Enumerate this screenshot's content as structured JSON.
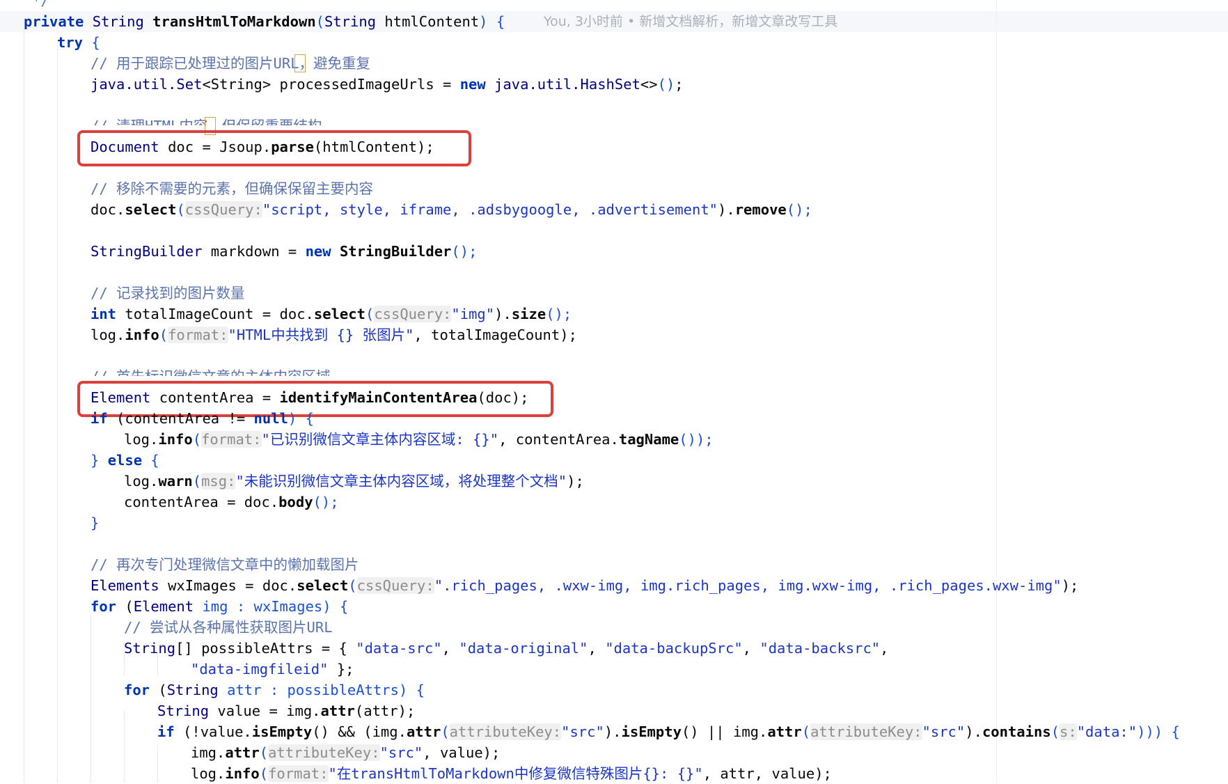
{
  "colors": {
    "keyword": "#0033b3",
    "comment": "#5b74ad",
    "string": "#1b35c9",
    "parameter_hint": "#8c8c8c",
    "highlight_box": "#d9413c",
    "background": "#ffffff"
  },
  "code": {
    "l0": {
      "comment": "*/"
    },
    "l1": {
      "kw_private": "private",
      "type": "String",
      "method": "transHtmlToMarkdown",
      "open": "(",
      "ptype": "String",
      "param": "htmlContent",
      "close": ") {",
      "blame": "You, 3小时前 • 新增文档解析，新增文章改写工具"
    },
    "l2": {
      "kw_try": "try",
      "brace": "{"
    },
    "l3": {
      "comment": "// 用于跟踪已处理过的图片URL，避免重复"
    },
    "l4": {
      "a": "java.util.",
      "b": "Set",
      "c": "<String> processedImageUrls = ",
      "kw_new": "new",
      "d": " java.util.",
      "e": "HashSet",
      "f": "<>",
      "g": "()",
      "h": ";"
    },
    "l5": {
      "comment": "// 清理HTML内容，但保留重要结构"
    },
    "l6": {
      "type": "Document",
      "a": " doc = Jsoup.",
      "fn": "parse",
      "b": "(htmlContent);"
    },
    "l7": {
      "comment": "// 移除不需要的元素，但确保保留主要内容"
    },
    "l8": {
      "a": "doc.",
      "fn": "select",
      "b": "(",
      "hint": "cssQuery:",
      "str": "\"script, style, iframe, .adsbygoogle, .advertisement\"",
      "c": ").",
      "fn2": "remove",
      "d": "();"
    },
    "l9": {
      "type": "StringBuilder",
      "a": " markdown = ",
      "kw_new": "new",
      "fn": "StringBuilder",
      "b": "();"
    },
    "l10": {
      "comment": "// 记录找到的图片数量"
    },
    "l11": {
      "kw_int": "int",
      "a": " totalImageCount = doc.",
      "fn": "select",
      "b": "(",
      "hint": "cssQuery:",
      "str": "\"img\"",
      "c": ").",
      "fn2": "size",
      "d": "();"
    },
    "l12": {
      "a": "log.",
      "fn": "info",
      "b": "(",
      "hint": "format:",
      "str": "\"HTML中共找到 {} 张图片\"",
      "c": ", totalImageCount);"
    },
    "l13": {
      "comment": "// 首先标识微信文章的主体内容区域"
    },
    "l14": {
      "type": "Element",
      "a": " contentArea = ",
      "fn": "identifyMainContentArea",
      "b": "(doc);"
    },
    "l15": {
      "kw_if": "if",
      "a": " (contentArea != ",
      "kw_null": "null",
      "b": ") {"
    },
    "l16": {
      "a": "log.",
      "fn": "info",
      "b": "(",
      "hint": "format:",
      "str": "\"已识别微信文章主体内容区域: {}\"",
      "c": ", contentArea.",
      "fn2": "tagName",
      "d": "());"
    },
    "l17": {
      "a": "} ",
      "kw_else": "else",
      "b": " {"
    },
    "l18": {
      "a": "log.",
      "fn": "warn",
      "b": "(",
      "hint": "msg:",
      "str": "\"未能识别微信文章主体内容区域，将处理整个文档\"",
      "c": ");"
    },
    "l19": {
      "a": "contentArea = doc.",
      "fn": "body",
      "b": "();"
    },
    "l20": {
      "a": "}"
    },
    "l21": {
      "comment": "// 再次专门处理微信文章中的懒加载图片"
    },
    "l22": {
      "type": "Elements",
      "a": " wxImages = doc.",
      "fn": "select",
      "b": "(",
      "hint": "cssQuery:",
      "str": "\".rich_pages, .wxw-img, img.rich_pages, img.wxw-img, .rich_pages.wxw-img\"",
      "c": ");"
    },
    "l23": {
      "kw_for": "for",
      "a": " (",
      "type": "Element",
      "b": " img : wxImages) {"
    },
    "l24": {
      "comment": "// 尝试从各种属性获取图片URL"
    },
    "l25": {
      "type": "String",
      "a": "[] possibleAttrs = { ",
      "s1": "\"data-src\"",
      "c1": ", ",
      "s2": "\"data-original\"",
      "c2": ", ",
      "s3": "\"data-backupSrc\"",
      "c3": ", ",
      "s4": "\"data-backsrc\"",
      "c4": ","
    },
    "l26": {
      "s5": "\"data-imgfileid\"",
      "a": " };"
    },
    "l27": {
      "kw_for": "for",
      "a": " (",
      "type": "String",
      "b": " attr : possibleAttrs) {"
    },
    "l28": {
      "type": "String",
      "a": " value = img.",
      "fn": "attr",
      "b": "(attr);"
    },
    "l29": {
      "kw_if": "if",
      "a": " (!value.",
      "fn": "isEmpty",
      "b": "() && (img.",
      "fn2": "attr",
      "c": "(",
      "hint": "attributeKey:",
      "str": "\"src\"",
      "d": ").",
      "fn3": "isEmpty",
      "e": "() || img.",
      "fn4": "attr",
      "f": "(",
      "hint2": "attributeKey:",
      "str2": "\"src\"",
      "g": ").",
      "fn5": "contains",
      "h": "(",
      "hint3": "s:",
      "str3": "\"data:\"",
      "i": "))) {"
    },
    "l30": {
      "a": "img.",
      "fn": "attr",
      "b": "(",
      "hint": "attributeKey:",
      "str": "\"src\"",
      "c": ", value);"
    },
    "l31": {
      "a": "log.",
      "fn": "info",
      "b": "(",
      "hint": "format:",
      "str": "\"在transHtmlToMarkdown中修复微信特殊图片{}: {}\"",
      "c": ", attr, value);"
    }
  }
}
